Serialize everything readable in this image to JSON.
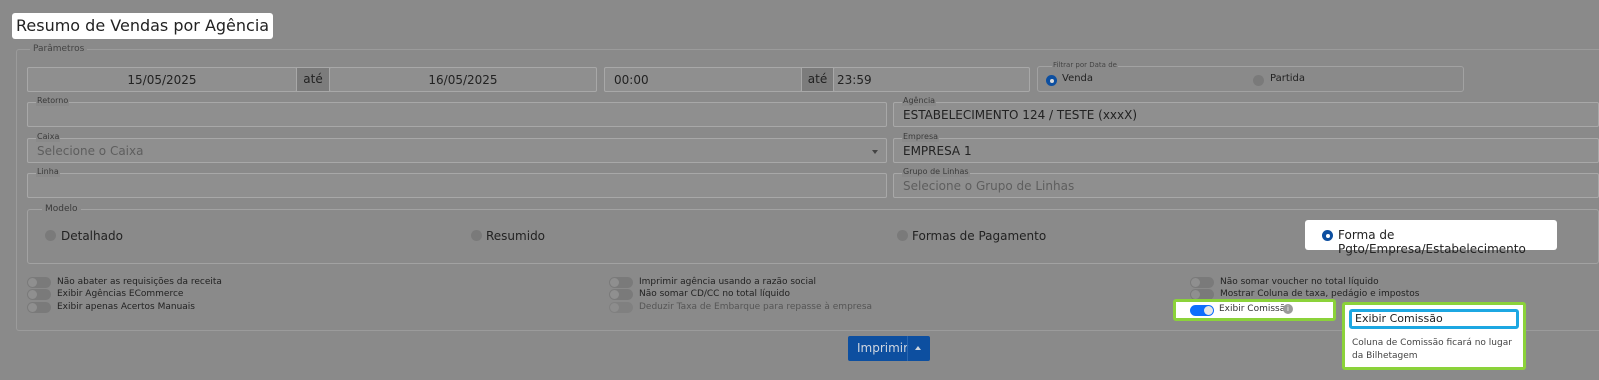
{
  "page": {
    "title": "Resumo de Vendas por Agência"
  },
  "params": {
    "legend": "Parâmetros",
    "date_start": "15/05/2025",
    "date_sep": "até",
    "date_end": "16/05/2025",
    "time_start": "00:00",
    "time_sep": "até",
    "time_end": "23:59",
    "filter": {
      "label": "Filtrar por Data de",
      "options": [
        "Venda",
        "Partida"
      ],
      "selected": "Venda"
    },
    "retorno": {
      "label": "Retorno",
      "value": ""
    },
    "agencia": {
      "label": "Agência",
      "value": "ESTABELECIMENTO 124 / TESTE (xxxX)"
    },
    "caixa": {
      "label": "Caixa",
      "placeholder": "Selecione o Caixa"
    },
    "empresa": {
      "label": "Empresa",
      "value": "EMPRESA 1"
    },
    "linha": {
      "label": "Linha",
      "value": ""
    },
    "grupo_linhas": {
      "label": "Grupo de Linhas",
      "placeholder": "Selecione o Grupo de Linhas"
    }
  },
  "modelo": {
    "legend": "Modelo",
    "options": [
      "Detalhado",
      "Resumido",
      "Formas de Pagamento",
      "Forma de Pgto/Empresa/Estabelecimento"
    ],
    "selected": "Forma de Pgto/Empresa/Estabelecimento"
  },
  "toggles": {
    "col1": [
      "Não abater as requisições da receita",
      "Exibir Agências ECommerce",
      "Exibir apenas Acertos Manuais"
    ],
    "col2": [
      "Imprimir agência usando a razão social",
      "Não somar CD/CC no total líquido",
      "Deduzir Taxa de Embarque para repasse à empresa"
    ],
    "col3": [
      "Não somar voucher no total líquido",
      "Mostrar Coluna de taxa, pedágio e impostos",
      "Exibir Comissão"
    ],
    "exibir_comissao_on": true
  },
  "tooltip": {
    "title": "Exibir Comissão",
    "body": "Coluna de Comissão ficará no lugar da Bilhetagem"
  },
  "actions": {
    "print_label": "Imprimir"
  },
  "colors": {
    "primary": "#0d4fa0",
    "highlight": "#8bd23a",
    "focus": "#1ca7e2"
  }
}
